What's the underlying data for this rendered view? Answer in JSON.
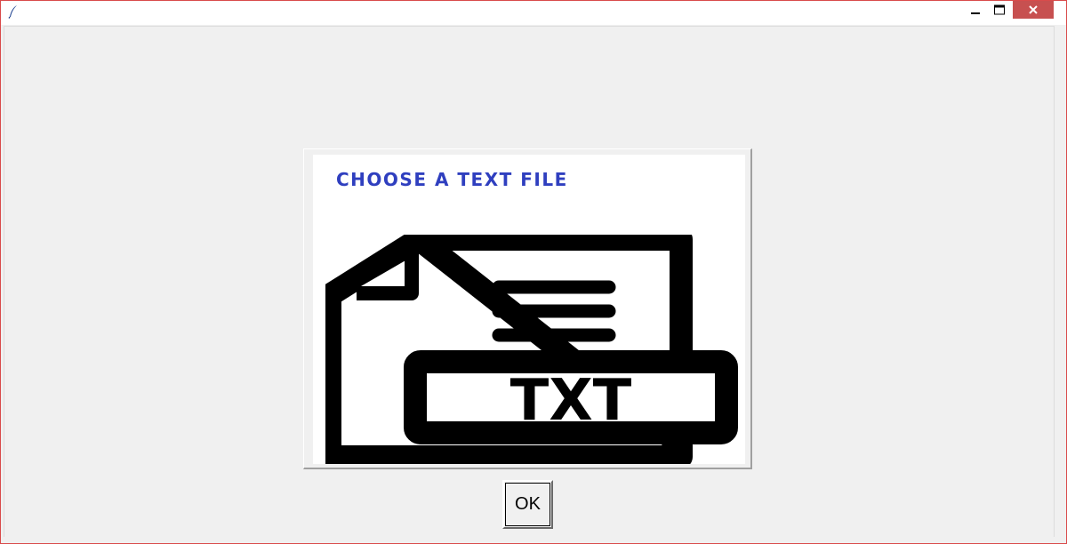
{
  "window": {
    "title": "",
    "buttons": {
      "minimize": "minimize-icon",
      "maximize": "maximize-icon",
      "close": "close-icon",
      "close_bg": "#c75050"
    }
  },
  "image": {
    "title": "CHOOSE A TEXT FILE",
    "title_color": "#2f3fbf",
    "badge_text": "TXT",
    "icon": "txt-file-icon"
  },
  "ok_button": {
    "label": "OK"
  }
}
